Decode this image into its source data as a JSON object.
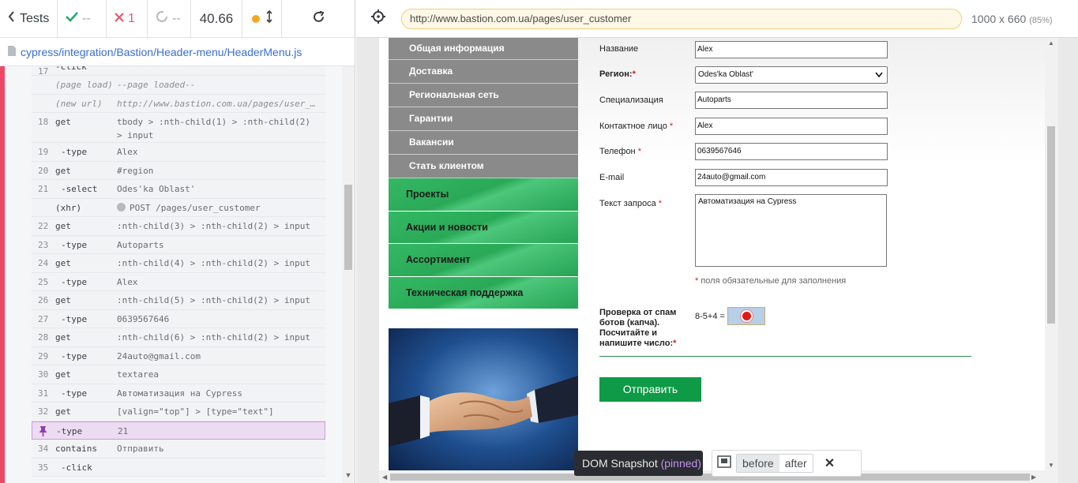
{
  "reporter": {
    "tests_label": "Tests",
    "passed": "--",
    "failed": "1",
    "pending": "--",
    "duration": "40.66",
    "spec_path": "cypress/integration/Bastion/Header-menu/HeaderMenu.js",
    "log": [
      {
        "num": "17",
        "cmd": "-click",
        "msg": "",
        "kind": "top"
      },
      {
        "num": "",
        "cmd": "(page load)",
        "msg": "--page loaded--",
        "kind": "event"
      },
      {
        "num": "",
        "cmd": "(new url)",
        "msg": "http://www.bastion.com.ua/pages/user_…",
        "kind": "event"
      },
      {
        "num": "18",
        "cmd": "get",
        "msg": "tbody > :nth-child(1) > :nth-child(2)\n> input",
        "kind": "cmd"
      },
      {
        "num": "19",
        "cmd": "-type",
        "msg": "Alex",
        "kind": "sub"
      },
      {
        "num": "20",
        "cmd": "get",
        "msg": "#region",
        "kind": "cmd"
      },
      {
        "num": "21",
        "cmd": "-select",
        "msg": "Odes'ka Oblast'",
        "kind": "sub"
      },
      {
        "num": "",
        "cmd": "(xhr)",
        "msg": "POST /pages/user_customer",
        "kind": "xhr"
      },
      {
        "num": "22",
        "cmd": "get",
        "msg": ":nth-child(3) > :nth-child(2) > input",
        "kind": "cmd"
      },
      {
        "num": "23",
        "cmd": "-type",
        "msg": "Autoparts",
        "kind": "sub"
      },
      {
        "num": "24",
        "cmd": "get",
        "msg": ":nth-child(4) > :nth-child(2) > input",
        "kind": "cmd"
      },
      {
        "num": "25",
        "cmd": "-type",
        "msg": "Alex",
        "kind": "sub"
      },
      {
        "num": "26",
        "cmd": "get",
        "msg": ":nth-child(5) > :nth-child(2) > input",
        "kind": "cmd"
      },
      {
        "num": "27",
        "cmd": "-type",
        "msg": "0639567646",
        "kind": "sub"
      },
      {
        "num": "28",
        "cmd": "get",
        "msg": ":nth-child(6) > :nth-child(2) > input",
        "kind": "cmd"
      },
      {
        "num": "29",
        "cmd": "-type",
        "msg": "24auto@gmail.com",
        "kind": "sub"
      },
      {
        "num": "30",
        "cmd": "get",
        "msg": "textarea",
        "kind": "cmd"
      },
      {
        "num": "31",
        "cmd": "-type",
        "msg": "Автоматизация на Cypress",
        "kind": "sub"
      },
      {
        "num": "32",
        "cmd": "get",
        "msg": "[valign=\"top\"] > [type=\"text\"]",
        "kind": "cmd"
      },
      {
        "num": "",
        "cmd": "-type",
        "msg": "21",
        "kind": "pinned"
      },
      {
        "num": "34",
        "cmd": "contains",
        "msg": "Отправить",
        "kind": "cmd"
      },
      {
        "num": "35",
        "cmd": "-click",
        "msg": "",
        "kind": "sub"
      }
    ]
  },
  "browser": {
    "url": "http://www.bastion.com.ua/pages/user_customer",
    "viewport": "1000 x 660",
    "zoom": "(85%)"
  },
  "site": {
    "gray_menu": [
      "Общая информация",
      "Доставка",
      "Региональная сеть",
      "Гарантии",
      "Вакансии",
      "Стать клиентом"
    ],
    "green_menu": [
      "Проекты",
      "Акции и новости",
      "Ассортимент",
      "Техническая поддержка"
    ],
    "form": {
      "name_label": "Название",
      "name_value": "Alex",
      "region_label": "Регион:",
      "region_value": "Odes'ka Oblast'",
      "spec_label": "Специализация",
      "spec_value": "Autoparts",
      "contact_label": "Контактное лицо",
      "contact_value": "Alex",
      "phone_label": "Телефон",
      "phone_value": "0639567646",
      "email_label": "E-mail",
      "email_value": "24auto@gmail.com",
      "request_label": "Текст запроса",
      "request_value": "Автоматизация на Cypress",
      "required_note": "поля обязательные для заполнения",
      "required_star": "*",
      "captcha_label": "Проверка от спам ботов (капча). Посчитайте и напишите число:",
      "captcha_expr": "8-5+4 =",
      "submit_label": "Отправить"
    }
  },
  "snapshot": {
    "label": "DOM Snapshot",
    "pinned": "(pinned)",
    "before": "before",
    "after": "after",
    "close": "✕"
  },
  "colors": {
    "fail_accent": "#ef4866",
    "pass_green": "#1fa971",
    "fail_red": "#e45770",
    "running_orange": "#f5a623",
    "site_green": "#0e9a47",
    "pinned_purple": "#c292ef"
  }
}
